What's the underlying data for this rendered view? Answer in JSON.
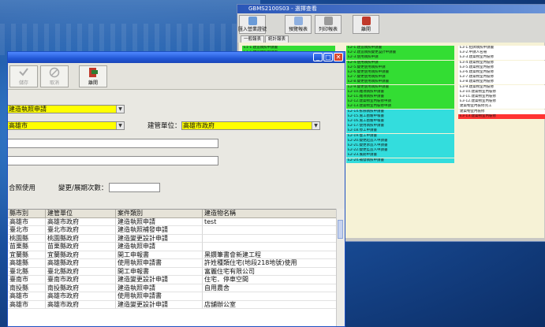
{
  "colors": {
    "accent_yellow": "#ffff00",
    "titlebar_blue": "#2157d6",
    "grid_green": "#33dd33",
    "grid_cyan": "#33dddd",
    "grid_red": "#ff3333"
  },
  "back_window": {
    "title": "GBMS2100S03 - 選擇查看",
    "toolbar": [
      {
        "label": "匯入營業證號",
        "icon": "import-icon"
      },
      {
        "label": "預覽報表",
        "icon": "preview-icon"
      },
      {
        "label": "列印報表",
        "icon": "print-icon"
      },
      {
        "label": "離開",
        "icon": "exit-icon"
      }
    ],
    "tabs": [
      "一般報表",
      "統計報表"
    ],
    "col1": [
      "E1-1.建造執照申請書",
      "E1-1.建造執照申請書",
      "",
      "",
      "",
      "",
      "",
      "",
      "",
      "",
      "",
      "",
      "",
      "",
      "",
      "",
      "",
      "",
      "",
      "",
      "",
      "",
      "",
      ""
    ],
    "col2": [
      "E2-1.建造執照申請書",
      "E2-2.建造執照變更設計申請書",
      "E2-3.使用執照申請",
      "E2-4.使用執照申請",
      "E2-5.變更使用執照申請",
      "E2-6.變更使用執照申請書",
      "E2-7.變更使用執照申請",
      "E2-8.變更使用執照申請書",
      "E2-9.變更使用執照申請書",
      "E2-10.雜項執照申請書",
      "E2-11.雜項執照申請書",
      "E2-12.建築物室內裝修申請",
      "E2-13.建築物室內裝修申請",
      "E2-14.拆除執照申請書",
      "E2-15.施工勘驗申報書",
      "E2-16.施工勘驗申報書",
      "E2-17.使用執照申請書",
      "E2-18.停工申請書",
      "E2-19.復工申請書",
      "E2-20.變更起造人申請書",
      "E2-21.變更承造人申請書",
      "E2-22.變更監造人申請書",
      "E2-23.展期申請書",
      "E2-24.補發執照申請書"
    ],
    "col3": [
      "E3-1.招牌執照申請書",
      "E3-2.申請人名冊",
      "E3-3.建築物室內裝修",
      "E3-4.建築物室內裝修",
      "E3-5.建築物室內裝修",
      "E3-6.建築物室內裝修",
      "E3-7.建築物室內裝修",
      "E3-8.建築物室內裝修",
      "E3-9.建築物室內裝修",
      "E3-10.建築物室內裝修",
      "E3-11.建築物室內裝修",
      "E3-12.建築物室內裝修",
      "建築物室內裝修完工",
      "建築物室內裝修",
      "E3-13.建築物室內裝修",
      "",
      "",
      "",
      "",
      "",
      "",
      "",
      "",
      ""
    ]
  },
  "front_window": {
    "toolbar": [
      {
        "label": "儲存",
        "icon": "check-icon",
        "enabled": false
      },
      {
        "label": "取消",
        "icon": "cancel-icon",
        "enabled": false
      },
      {
        "label": "離開",
        "icon": "exit-icon",
        "enabled": true
      }
    ],
    "form": {
      "application_type": "建造執照申請",
      "county": "高雄市",
      "agency_label": "建管單位：",
      "agency_value": "高雄市政府",
      "change_count_label": "變更/展期次數：",
      "usage_label": "合照使用"
    },
    "table": {
      "headers": [
        "縣市別",
        "建管單位",
        "案件類別",
        "建造物名稱"
      ],
      "rows": [
        [
          "高雄市",
          "高雄市政府",
          "建造執照申請",
          "test"
        ],
        [
          "臺北市",
          "臺北市政府",
          "建造執照補發申請",
          ""
        ],
        [
          "桃園縣",
          "桃園縣政府",
          "建造變更設計申請",
          ""
        ],
        [
          "苗栗縣",
          "苗栗縣政府",
          "建造執照申請",
          ""
        ],
        [
          "宜蘭縣",
          "宜蘭縣政府",
          "開工申報書",
          "黑鑽筆書會新建工程"
        ],
        [
          "高雄縣",
          "高雄縣政府",
          "使用執照申請書",
          "許姓種類住宅(地段218地號)使用"
        ],
        [
          "臺北縣",
          "臺北縣政府",
          "開工申報書",
          "富麗住宅有限公司"
        ],
        [
          "臺南市",
          "臺南市政府",
          "建造變更設計申請",
          "住宅．停車空間"
        ],
        [
          "南投縣",
          "南投縣政府",
          "建造執照申請",
          "自用農舍"
        ],
        [
          "高雄市",
          "高雄市政府",
          "使用執照申請書",
          ""
        ],
        [
          "高雄市",
          "高雄市政府",
          "建造變更設計申請",
          "店舖辦公室"
        ]
      ]
    }
  }
}
